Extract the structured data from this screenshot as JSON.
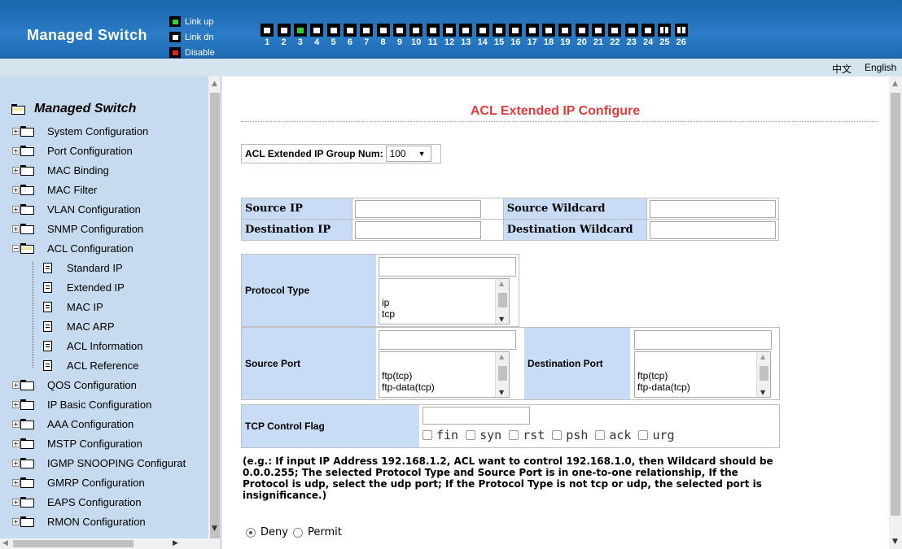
{
  "header": {
    "brand": "Managed Switch",
    "legend": [
      {
        "label": "Link up",
        "color": "#2fd02f"
      },
      {
        "label": "Link dn",
        "color": "#ffffff"
      },
      {
        "label": "Disable",
        "color": "#e02020"
      }
    ],
    "ports": [
      {
        "num": "1",
        "state": "dn"
      },
      {
        "num": "2",
        "state": "dn"
      },
      {
        "num": "3",
        "state": "up"
      },
      {
        "num": "4",
        "state": "dn"
      },
      {
        "num": "5",
        "state": "dn"
      },
      {
        "num": "6",
        "state": "dn"
      },
      {
        "num": "7",
        "state": "dn"
      },
      {
        "num": "8",
        "state": "dn"
      },
      {
        "num": "9",
        "state": "dn"
      },
      {
        "num": "10",
        "state": "dn"
      },
      {
        "num": "11",
        "state": "dn"
      },
      {
        "num": "12",
        "state": "dn"
      },
      {
        "num": "13",
        "state": "dn"
      },
      {
        "num": "14",
        "state": "dn"
      },
      {
        "num": "15",
        "state": "dn"
      },
      {
        "num": "16",
        "state": "dn"
      },
      {
        "num": "17",
        "state": "dn"
      },
      {
        "num": "18",
        "state": "dn"
      },
      {
        "num": "19",
        "state": "dn"
      },
      {
        "num": "20",
        "state": "dn"
      },
      {
        "num": "21",
        "state": "dn"
      },
      {
        "num": "22",
        "state": "dn"
      },
      {
        "num": "23",
        "state": "dn"
      },
      {
        "num": "24",
        "state": "dn"
      },
      {
        "num": "25",
        "state": "fiber"
      },
      {
        "num": "26",
        "state": "fiber"
      }
    ]
  },
  "langbar": {
    "chinese": "中文",
    "english": "English"
  },
  "sidebar": {
    "root": "Managed Switch",
    "items": [
      {
        "label": "System Configuration",
        "level": 0,
        "icon": "folder-icon"
      },
      {
        "label": "Port Configuration",
        "level": 0,
        "icon": "folder-icon"
      },
      {
        "label": "MAC Binding",
        "level": 0,
        "icon": "folder-icon"
      },
      {
        "label": "MAC Filter",
        "level": 0,
        "icon": "folder-icon"
      },
      {
        "label": "VLAN Configuration",
        "level": 0,
        "icon": "folder-icon"
      },
      {
        "label": "SNMP Configuration",
        "level": 0,
        "icon": "folder-icon"
      },
      {
        "label": "ACL Configuration",
        "level": 0,
        "icon": "folder-open-icon",
        "expanded": true
      },
      {
        "label": "Standard IP",
        "level": 1,
        "icon": "document-icon"
      },
      {
        "label": "Extended IP",
        "level": 1,
        "icon": "document-icon"
      },
      {
        "label": "MAC IP",
        "level": 1,
        "icon": "document-icon"
      },
      {
        "label": "MAC ARP",
        "level": 1,
        "icon": "document-icon"
      },
      {
        "label": "ACL Information",
        "level": 1,
        "icon": "document-icon"
      },
      {
        "label": "ACL Reference",
        "level": 1,
        "icon": "document-icon"
      },
      {
        "label": "QOS Configuration",
        "level": 0,
        "icon": "folder-icon"
      },
      {
        "label": "IP Basic Configuration",
        "level": 0,
        "icon": "folder-icon"
      },
      {
        "label": "AAA Configuration",
        "level": 0,
        "icon": "folder-icon"
      },
      {
        "label": "MSTP Configuration",
        "level": 0,
        "icon": "folder-icon"
      },
      {
        "label": "IGMP SNOOPING Configurat",
        "level": 0,
        "icon": "folder-icon"
      },
      {
        "label": "GMRP Configuration",
        "level": 0,
        "icon": "folder-icon"
      },
      {
        "label": "EAPS Configuration",
        "level": 0,
        "icon": "folder-icon"
      },
      {
        "label": "RMON Configuration",
        "level": 0,
        "icon": "folder-icon"
      }
    ]
  },
  "main": {
    "title": "ACL Extended IP Configure",
    "group": {
      "label": "ACL Extended IP Group Num:",
      "value": "100"
    },
    "addr": {
      "source_ip": "Source IP",
      "source_wildcard": "Source Wildcard",
      "dest_ip": "Destination IP",
      "dest_wildcard": "Destination Wildcard"
    },
    "protocol": {
      "label": "Protocol Type",
      "value": "",
      "options": [
        "ip",
        "tcp"
      ]
    },
    "source_port": {
      "label": "Source Port",
      "value": "",
      "options": [
        "ftp(tcp)",
        "ftp-data(tcp)"
      ]
    },
    "dest_port": {
      "label": "Destination Port",
      "value": "",
      "options": [
        "ftp(tcp)",
        "ftp-data(tcp)"
      ]
    },
    "tcp_flag": {
      "label": "TCP Control Flag",
      "value": "",
      "flags": [
        "fin",
        "syn",
        "rst",
        "psh",
        "ack",
        "urg"
      ]
    },
    "note": "(e.g.: If input IP Address 192.168.1.2, ACL want to control 192.168.1.0, then Wildcard should be 0.0.0.255; The selected Protocol Type and Source Port is in one-to-one relationship, If the Protocol is udp, select the udp port; If the Protocol Type is not tcp or udp, the selected port is insignificance.)",
    "action": {
      "deny": "Deny",
      "permit": "Permit",
      "selected": "deny"
    }
  }
}
